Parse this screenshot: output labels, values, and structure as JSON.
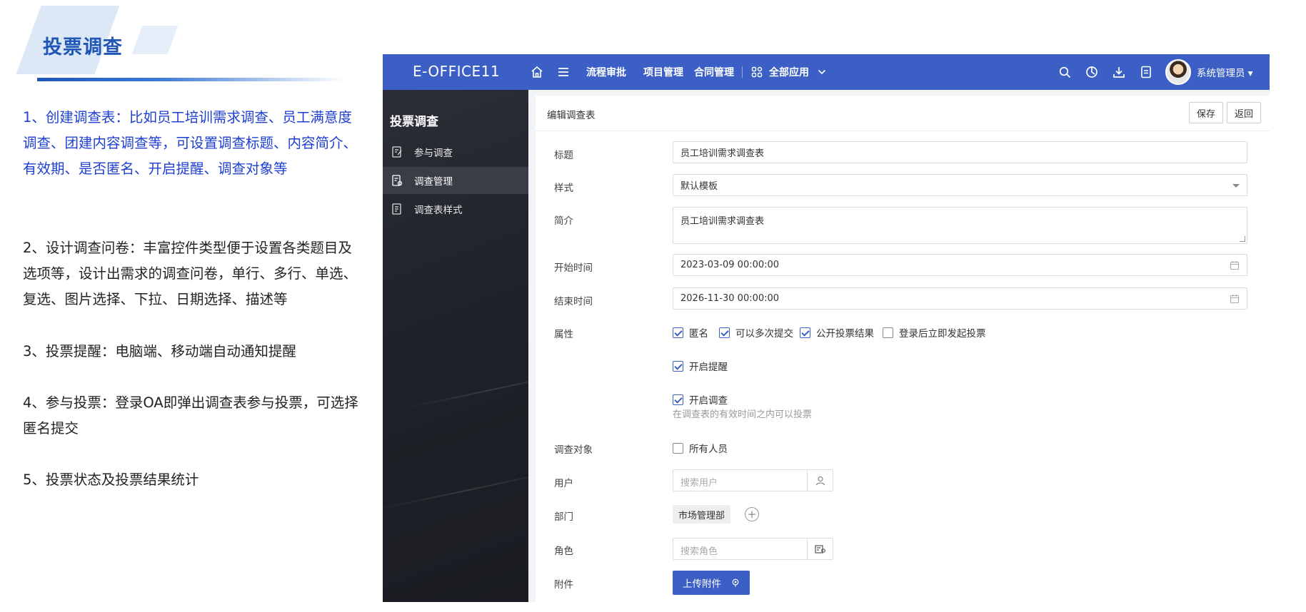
{
  "promo": {
    "heading": "投票调查",
    "items": [
      "1、创建调查表：比如员工培训需求调查、员工满意度调查、团建内容调查等，可设置调查标题、内容简介、有效期、是否匿名、开启提醒、调查对象等",
      "2、设计调查问卷：丰富控件类型便于设置各类题目及选项等，设计出需求的调查问卷，单行、多行、单选、复选、图片选择、下拉、日期选择、描述等",
      "3、投票提醒：电脑端、移动端自动通知提醒",
      "4、参与投票：登录OA即弹出调查表参与投票，可选择匿名提交",
      "5、投票状态及投票结果统计"
    ]
  },
  "topbar": {
    "brand": "E-OFFICE11",
    "links": [
      "流程审批",
      "项目管理",
      "合同管理"
    ],
    "all_apps": "全部应用",
    "user": "系统管理员",
    "icons": [
      "home-icon",
      "menu-icon",
      "apps-grid-icon",
      "chevron-down-icon",
      "search-icon",
      "power-icon",
      "download-icon",
      "document-icon",
      "avatar"
    ]
  },
  "sidebar": {
    "title": "投票调查",
    "items": [
      {
        "label": "参与调查",
        "icon": "edit-form-icon",
        "active": false
      },
      {
        "label": "调查管理",
        "icon": "manage-form-icon",
        "active": true
      },
      {
        "label": "调查表样式",
        "icon": "style-form-icon",
        "active": false
      }
    ]
  },
  "form": {
    "header_title": "编辑调查表",
    "save": "保存",
    "back": "返回",
    "labels": {
      "title": "标题",
      "style": "样式",
      "intro": "简介",
      "start": "开始时间",
      "end": "结束时间",
      "attrs": "属性",
      "target": "调查对象",
      "user": "用户",
      "dept": "部门",
      "role": "角色",
      "attach": "附件"
    },
    "values": {
      "title": "员工培训需求调查表",
      "style": "默认模板",
      "intro": "员工培训需求调查表",
      "start": "2023-03-09 00:00:00",
      "end": "2026-11-30 00:00:00"
    },
    "attributes": [
      {
        "label": "匿名",
        "checked": true
      },
      {
        "label": "可以多次提交",
        "checked": true
      },
      {
        "label": "公开投票结果",
        "checked": true
      },
      {
        "label": "登录后立即发起投票",
        "checked": false
      }
    ],
    "reminder": {
      "label": "开启提醒",
      "checked": true
    },
    "open_survey": {
      "label": "开启调查",
      "checked": true,
      "hint": "在调查表的有效时间之内可以投票"
    },
    "all_people": {
      "label": "所有人员",
      "checked": false
    },
    "user_placeholder": "搜索用户",
    "dept_tag": "市场管理部",
    "role_placeholder": "搜索角色",
    "upload_label": "上传附件"
  },
  "colors": {
    "primary": "#3b5fc4",
    "promo_blue": "#1e3fd0",
    "heading_blue": "#1f56b8",
    "sidebar_bg": "#20232a"
  }
}
